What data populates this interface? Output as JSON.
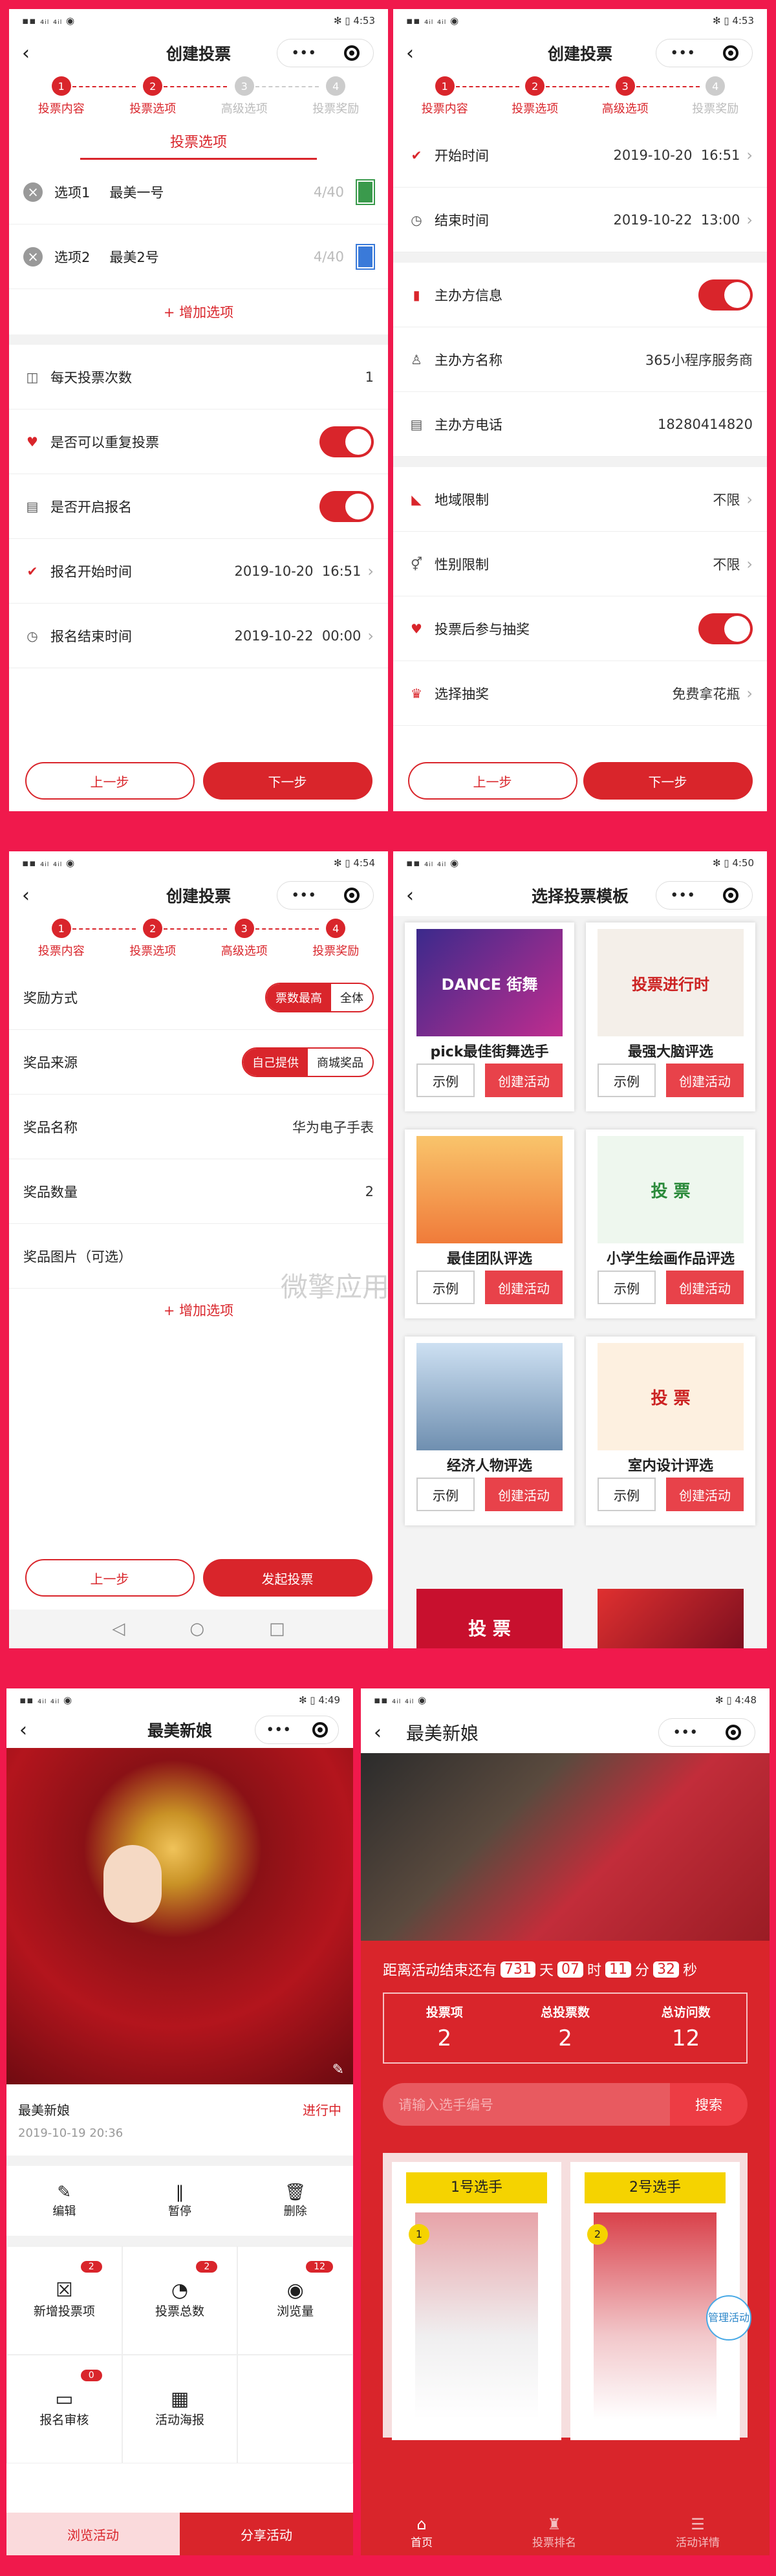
{
  "colors": {
    "accent": "#d9252b",
    "frame": "#f0194c"
  },
  "status": {
    "s1_time": "4:53",
    "s2_time": "4:53",
    "s3_time": "4:54",
    "s4_time": "4:50",
    "s5_time": "4:49",
    "s6_time": "4:48"
  },
  "create": {
    "title": "创建投票",
    "prev": "上一步",
    "next": "下一步",
    "publish": "发起投票",
    "steps": [
      "投票内容",
      "投票选项",
      "高级选项",
      "投票奖励"
    ],
    "nums": [
      "1",
      "2",
      "3",
      "4"
    ]
  },
  "s1": {
    "section": "投票选项",
    "options": [
      {
        "label": "选项1",
        "value": "最美一号",
        "count": "4/40"
      },
      {
        "label": "选项2",
        "value": "最美2号",
        "count": "4/40"
      }
    ],
    "add": "+ 增加选项",
    "daily_label": "每天投票次数",
    "daily_value": "1",
    "repeat_label": "是否可以重复投票",
    "reg_label": "是否开启报名",
    "reg_start_label": "报名开始时间",
    "reg_start_date": "2019-10-20",
    "reg_start_time": "16:51",
    "reg_end_label": "报名结束时间",
    "reg_end_date": "2019-10-22",
    "reg_end_time": "00:00"
  },
  "s2": {
    "start_label": "开始时间",
    "start_date": "2019-10-20",
    "start_time": "16:51",
    "end_label": "结束时间",
    "end_date": "2019-10-22",
    "end_time": "13:00",
    "host_info": "主办方信息",
    "host_name_label": "主办方名称",
    "host_name": "365小程序服务商",
    "host_phone_label": "主办方电话",
    "host_phone": "18280414820",
    "region_label": "地域限制",
    "region_value": "不限",
    "gender_label": "性别限制",
    "gender_value": "不限",
    "lottery_label": "投票后参与抽奖",
    "choose_label": "选择抽奖",
    "choose_value": "免费拿花瓶"
  },
  "s3": {
    "reward_label": "奖励方式",
    "reward_opts": [
      "票数最高",
      "全体"
    ],
    "source_label": "奖品来源",
    "source_opts": [
      "自己提供",
      "商城奖品"
    ],
    "prize_name_label": "奖品名称",
    "prize_name": "华为电子手表",
    "prize_qty_label": "奖品数量",
    "prize_qty": "2",
    "prize_img_label": "奖品图片（可选）",
    "add": "+ 增加选项",
    "watermark": "微擎应用商城"
  },
  "s4": {
    "title": "选择投票模板",
    "demo": "示例",
    "create": "创建活动",
    "templates": [
      {
        "name": "pick最佳街舞选手",
        "img": "DANCE 街舞"
      },
      {
        "name": "最强大脑评选",
        "img": "投票进行时"
      },
      {
        "name": "最佳团队评选",
        "img": ""
      },
      {
        "name": "小学生绘画作品评选",
        "img": "投 票"
      },
      {
        "name": "经济人物评选",
        "img": ""
      },
      {
        "name": "室内设计评选",
        "img": "投 票"
      }
    ],
    "extra_img": "投 票"
  },
  "s5": {
    "title": "最美新娘",
    "name": "最美新娘",
    "state": "进行中",
    "date": "2019-10-19 20:36",
    "actions": [
      "编辑",
      "暂停",
      "删除"
    ],
    "stats": [
      {
        "label": "新增投票项",
        "badge": "2"
      },
      {
        "label": "投票总数",
        "badge": "2"
      },
      {
        "label": "浏览量",
        "badge": "12"
      },
      {
        "label": "报名审核",
        "badge": "0"
      },
      {
        "label": "活动海报",
        "badge": ""
      }
    ],
    "browse": "浏览活动",
    "share": "分享活动"
  },
  "s6": {
    "title": "最美新娘",
    "countdown_prefix": "距离活动结束还有",
    "d": "731",
    "d_u": "天",
    "h": "07",
    "h_u": "时",
    "m": "11",
    "m_u": "分",
    "s": "32",
    "s_u": "秒",
    "cols": [
      {
        "label": "投票项",
        "value": "2"
      },
      {
        "label": "总投票数",
        "value": "2"
      },
      {
        "label": "总访问数",
        "value": "12"
      }
    ],
    "search_ph": "请输入选手编号",
    "search_btn": "搜索",
    "players": [
      {
        "title": "1号选手",
        "no": "1"
      },
      {
        "title": "2号选手",
        "no": "2"
      }
    ],
    "manage": "管理活动",
    "tabs": [
      "首页",
      "投票排名",
      "活动详情"
    ]
  }
}
